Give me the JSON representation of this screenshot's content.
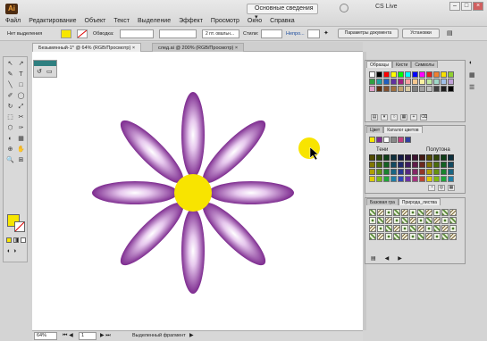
{
  "app": {
    "logo": "Ai",
    "workspace": "Основные сведения",
    "cs_live": "CS Live"
  },
  "menu": [
    "Файл",
    "Редактирование",
    "Объект",
    "Текст",
    "Выделение",
    "Эффект",
    "Просмотр",
    "Окно",
    "Справка"
  ],
  "window_controls": [
    "–",
    "□",
    "×"
  ],
  "controlbar": {
    "no_selection": "Нет выделения",
    "stroke_label": "Обводка:",
    "brush_value": "2 пт. овальн...",
    "styles_label": "Стили:",
    "opacity_label": "Непро...",
    "doc_settings": "Параметры документа",
    "settings": "Установки",
    "fill_color": "#f7e600"
  },
  "tabs": [
    {
      "label": "Безымянный-1* @ 64% (RGB/Просмотр)",
      "close": "×"
    },
    {
      "label": "след.ai @ 200% (RGB/Просмотр)",
      "close": "×"
    }
  ],
  "status": {
    "zoom": "64%",
    "page": "1",
    "mode": "Выделенный фрагмент"
  },
  "toolbox": {
    "fill_color": "#f7e600",
    "tools": [
      "↖",
      "↗",
      "✎",
      "T",
      "╲",
      "□",
      "✐",
      "◯",
      "↻",
      "⤢",
      "⬚",
      "✂",
      "⬡",
      "✑",
      "◐",
      "▦",
      "⊕",
      "✋",
      "🔍",
      "⊞"
    ]
  },
  "flower": {
    "petal_color": "#7d2b8f",
    "center_color": "#f8e400"
  },
  "swatches_panel": {
    "tabs": [
      "Образцы",
      "Кисти",
      "Символы"
    ],
    "colors": [
      "#ffffff",
      "#000000",
      "#ff0000",
      "#ffff00",
      "#00ff00",
      "#00ffff",
      "#0000ff",
      "#ff00ff",
      "#e02020",
      "#f08030",
      "#f8e000",
      "#90d030",
      "#30a040",
      "#20a0a0",
      "#2060c0",
      "#6030a0",
      "#a02080",
      "#f8a0a0",
      "#f8c890",
      "#f8f0a0",
      "#c0e8a0",
      "#a0d8c8",
      "#a0c0e8",
      "#c0a0d8",
      "#e0a0c8",
      "#603010",
      "#805030",
      "#a07040",
      "#c0a070",
      "#d8c8a0",
      "#808080",
      "#a0a0a0",
      "#c0c0c0",
      "#404040",
      "#202020",
      "#000000"
    ]
  },
  "guide_panel": {
    "tabs": [
      "Цвет",
      "Каталог цветов"
    ],
    "col_left": "Тени",
    "col_right": "Полутона",
    "base_colors": [
      "#f8e600",
      "#7d2b8f",
      "#ffffff",
      "#888888",
      "#c04080",
      "#3040a0"
    ],
    "shade_columns": [
      "#b8a800",
      "#6a9a10",
      "#1a8a30",
      "#1a6a8a",
      "#2a3a9a",
      "#5a2a8a",
      "#8a2a6a",
      "#9a3a2a"
    ]
  },
  "brushes_panel": {
    "tabs": [
      "Базовая гра",
      "Природа_листва"
    ]
  }
}
